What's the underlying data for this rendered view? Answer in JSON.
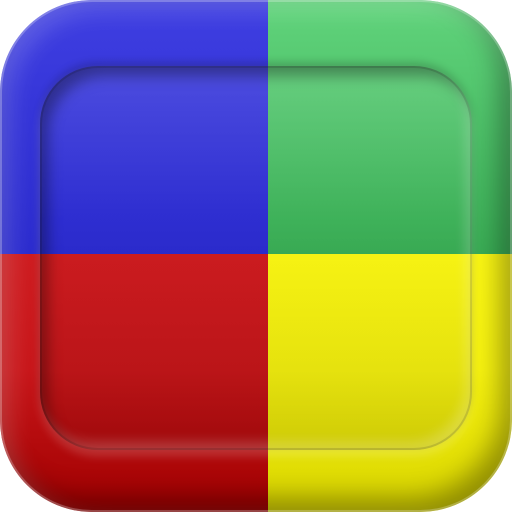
{
  "icon": {
    "name": "four-color-squares-app-icon",
    "colors": {
      "top_left": "#3535d8",
      "top_right": "#4fc26a",
      "bottom_left": "#c8161a",
      "bottom_right": "#f6f20f"
    }
  }
}
